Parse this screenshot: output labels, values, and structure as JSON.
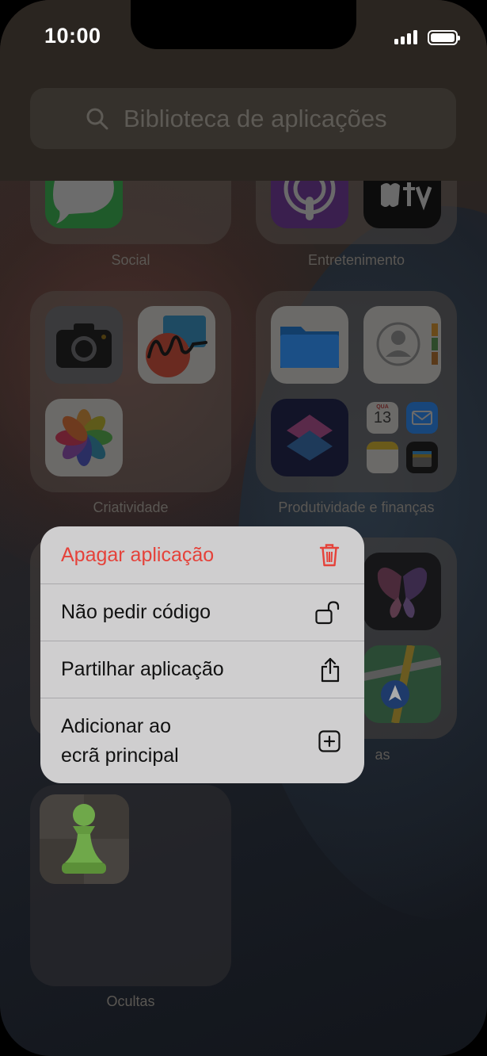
{
  "status_bar": {
    "time": "10:00"
  },
  "search": {
    "placeholder": "Biblioteca de aplicações"
  },
  "folders": {
    "social": "Social",
    "entertainment": "Entretenimento",
    "creativity": "Criatividade",
    "productivity": "Produtividade e finanças",
    "partial_label": "as",
    "hidden": "Ocultas"
  },
  "calendar_mini": {
    "weekday": "QUA",
    "day": "13"
  },
  "context_menu": {
    "items": [
      {
        "label": "Apagar aplicação",
        "icon": "trash-icon",
        "color": "#e5423a"
      },
      {
        "label": "Não pedir código",
        "icon": "unlock-icon"
      },
      {
        "label": "Partilhar aplicação",
        "icon": "share-icon"
      },
      {
        "label_line1": "Adicionar ao",
        "label_line2": "ecrã principal",
        "icon": "add-square-icon"
      }
    ]
  },
  "colors": {
    "destructive": "#e5423a",
    "menu_bg": "#cfcecf"
  }
}
